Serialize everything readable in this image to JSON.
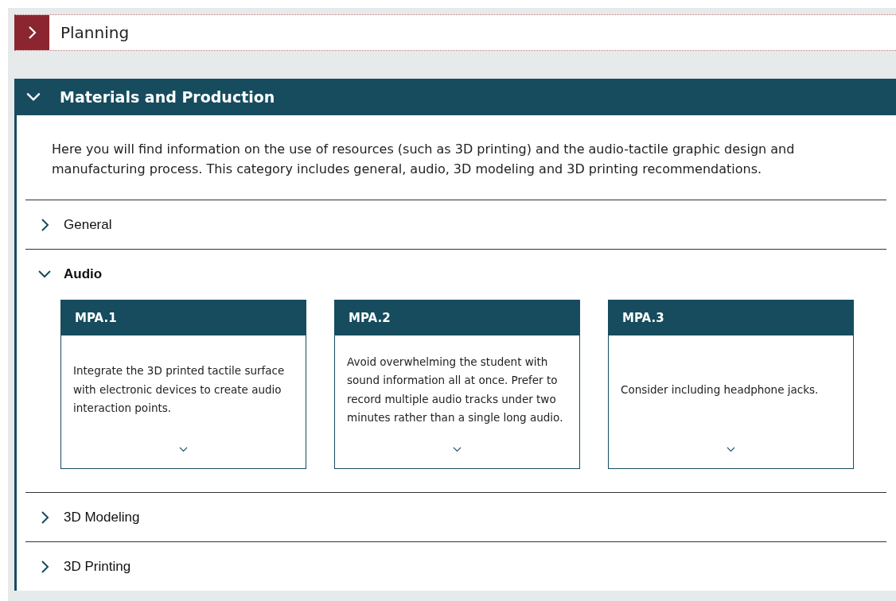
{
  "categories": [
    {
      "title": "Planning",
      "expanded": false
    },
    {
      "title": "Materials and Production",
      "expanded": true,
      "description": "Here you will find information on the use of resources (such as 3D printing) and the audio-tactile graphic design and manufacturing process. This category includes general, audio, 3D modeling and 3D printing recommendations.",
      "sections": [
        {
          "title": "General",
          "expanded": false
        },
        {
          "title": "Audio",
          "expanded": true,
          "cards": [
            {
              "code": "MPA.1",
              "text": "Integrate the 3D printed tactile surface with electronic devices to create audio interaction points."
            },
            {
              "code": "MPA.2",
              "text": "Avoid overwhelming the student with sound information all at once. Prefer to record multiple audio tracks under two minutes rather than a single long audio."
            },
            {
              "code": "MPA.3",
              "text": "Consider including headphone jacks."
            }
          ]
        },
        {
          "title": "3D Modeling",
          "expanded": false
        },
        {
          "title": "3D Printing",
          "expanded": false
        }
      ]
    }
  ]
}
